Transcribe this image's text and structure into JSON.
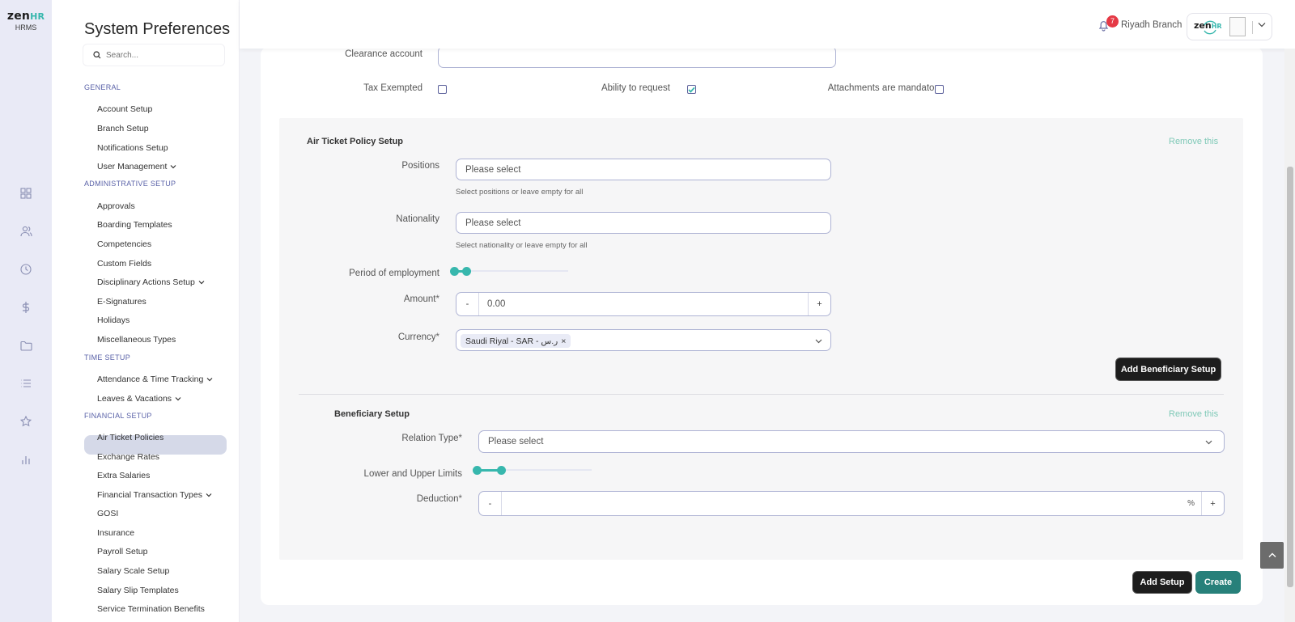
{
  "brand": {
    "logo_main": "zen",
    "logo_accent": "HR",
    "logo_sub": "HRMS"
  },
  "rail_icons": [
    "dashboard-icon",
    "people-icon",
    "clock-icon",
    "dollar-icon",
    "folder-icon",
    "list-icon",
    "star-icon",
    "chart-icon"
  ],
  "sidebar": {
    "title": "System Preferences",
    "search_placeholder": "Search...",
    "sections": {
      "general": "GENERAL",
      "admin": "ADMINISTRATIVE SETUP",
      "time": "TIME SETUP",
      "financial": "FINANCIAL SETUP"
    },
    "items": {
      "account_setup": "Account Setup",
      "branch_setup": "Branch Setup",
      "notifications_setup": "Notifications Setup",
      "user_management": "User Management",
      "approvals": "Approvals",
      "boarding_templates": "Boarding Templates",
      "competencies": "Competencies",
      "custom_fields": "Custom Fields",
      "disciplinary_actions_setup": "Disciplinary Actions Setup",
      "e_signatures": "E-Signatures",
      "holidays": "Holidays",
      "miscellaneous_types": "Miscellaneous Types",
      "attendance_time_tracking": "Attendance & Time Tracking",
      "leaves_vacations": "Leaves & Vacations",
      "air_ticket_policies": "Air Ticket Policies",
      "exchange_rates": "Exchange Rates",
      "extra_salaries": "Extra Salaries",
      "financial_transaction_types": "Financial Transaction Types",
      "gosi": "GOSI",
      "insurance": "Insurance",
      "payroll_setup": "Payroll Setup",
      "salary_scale_setup": "Salary Scale Setup",
      "salary_slip_templates": "Salary Slip Templates",
      "service_termination_benefits": "Service Termination Benefits"
    }
  },
  "topbar": {
    "notification_count": "7",
    "branch": "Riyadh Branch",
    "profile_logo_main": "zen",
    "profile_logo_accent": "HR"
  },
  "form": {
    "clearance_account_label": "Clearance account",
    "clearance_account_value": "",
    "tax_exempted_label": "Tax Exempted",
    "tax_exempted_checked": false,
    "ability_to_request_label": "Ability to request",
    "ability_to_request_checked": true,
    "attachments_mandatory_label": "Attachments are mandatory",
    "attachments_mandatory_checked": false
  },
  "air_ticket_policy": {
    "title": "Air Ticket Policy Setup",
    "remove_label": "Remove this",
    "positions_label": "Positions",
    "positions_placeholder": "Please select",
    "positions_hint": "Select positions or leave empty for all",
    "nationality_label": "Nationality",
    "nationality_placeholder": "Please select",
    "nationality_hint": "Select nationality or leave empty for all",
    "period_label": "Period of employment",
    "amount_label": "Amount",
    "amount_value": "0.00",
    "minus_label": "-",
    "plus_label": "+",
    "currency_label": "Currency",
    "currency_tag": "Saudi Riyal - SAR - ر.س",
    "tag_close": "×",
    "required_mark": "*",
    "add_beneficiary_button": "Add Beneficiary Setup"
  },
  "beneficiary": {
    "title": "Beneficiary Setup",
    "remove_label": "Remove this",
    "relation_type_label": "Relation Type",
    "relation_type_placeholder": "Please select",
    "limits_label": "Lower and Upper Limits",
    "deduction_label": "Deduction",
    "deduction_value": "",
    "percent_symbol": "%",
    "minus_label": "-",
    "plus_label": "+",
    "required_mark": "*"
  },
  "actions": {
    "add_setup_button": "Add Setup",
    "create_button": "Create"
  },
  "colors": {
    "accent_teal": "#37b7ad",
    "create_button": "#27807a",
    "dark_button": "#1d1d1d",
    "notification_badge": "#e53945",
    "section_heading": "#5a62a8"
  }
}
